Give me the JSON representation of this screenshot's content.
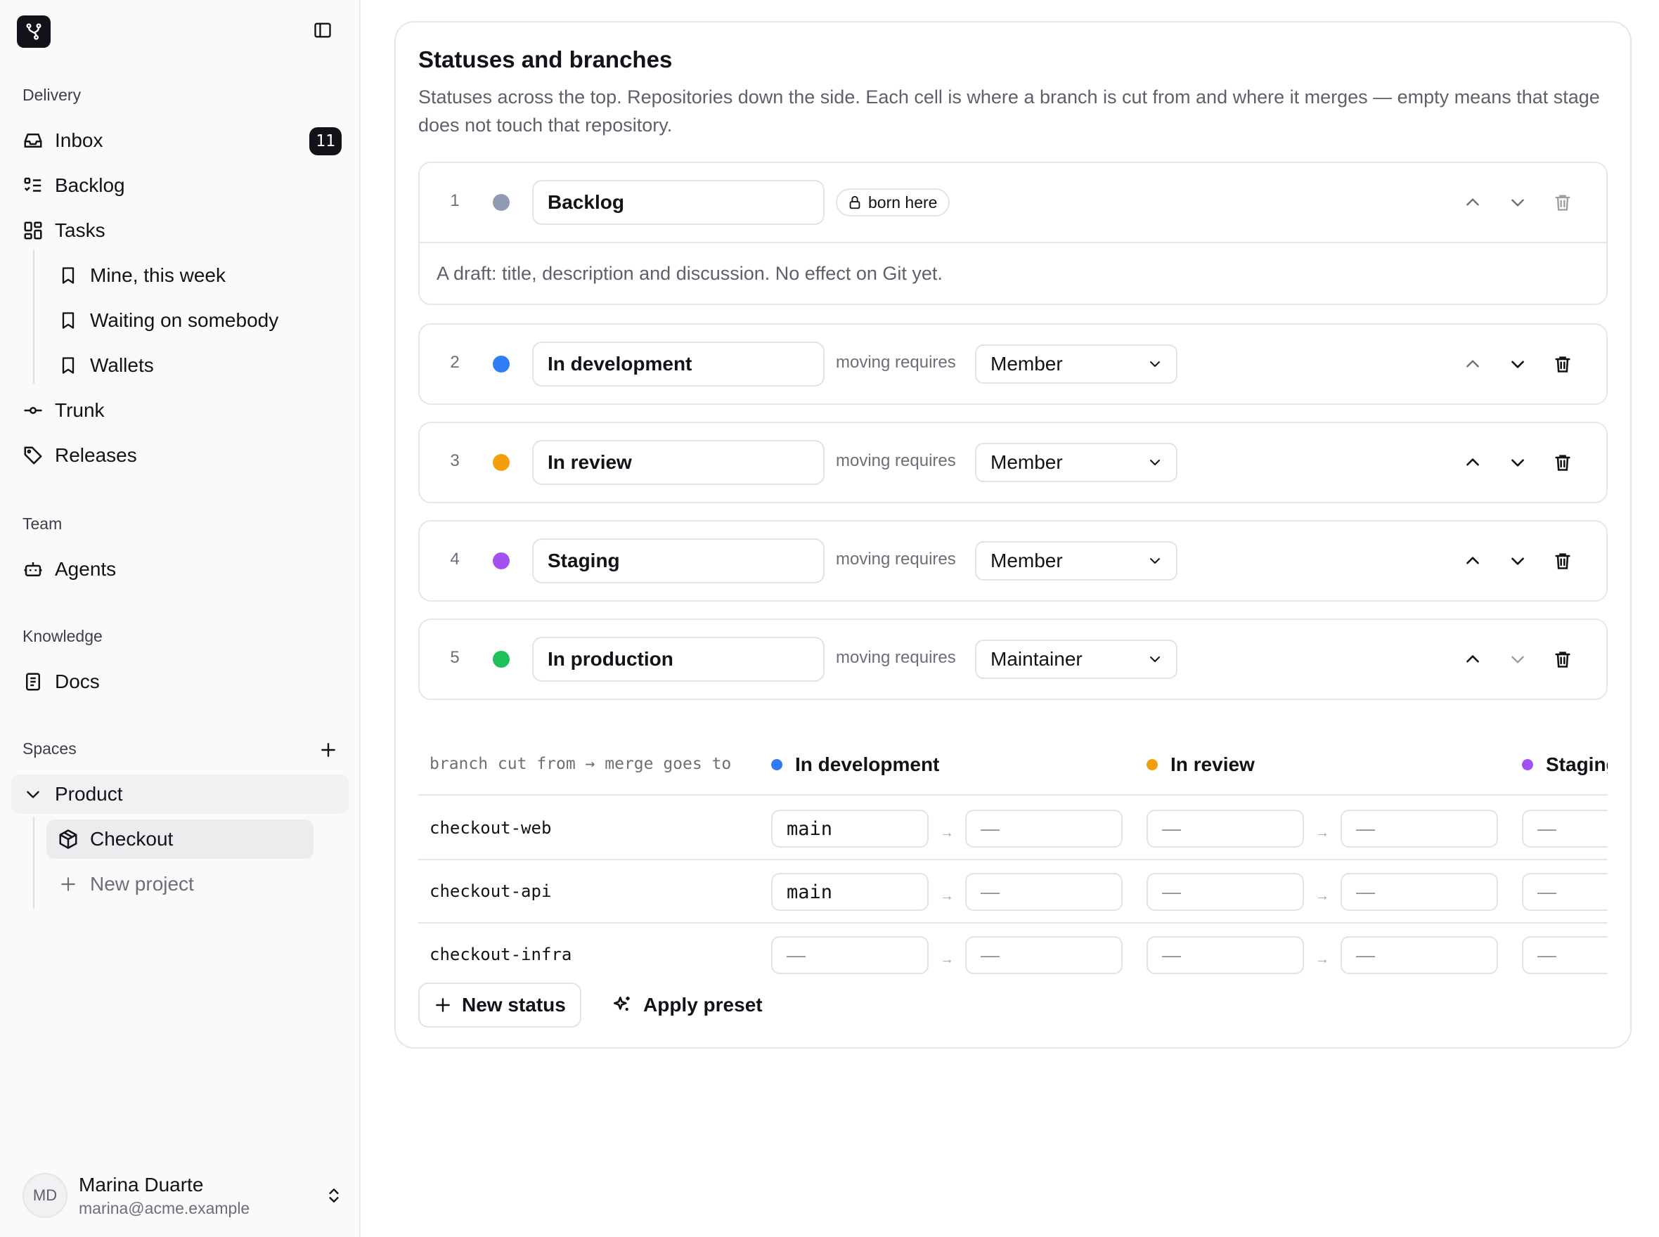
{
  "sidebar": {
    "sections": {
      "delivery": "Delivery",
      "team": "Team",
      "knowledge": "Knowledge",
      "spaces": "Spaces"
    },
    "items": {
      "inbox": {
        "label": "Inbox",
        "badge": "11"
      },
      "backlog": {
        "label": "Backlog"
      },
      "tasks": {
        "label": "Tasks"
      },
      "mine": {
        "label": "Mine, this week"
      },
      "waiting": {
        "label": "Waiting on somebody"
      },
      "wallets": {
        "label": "Wallets"
      },
      "trunk": {
        "label": "Trunk"
      },
      "releases": {
        "label": "Releases"
      },
      "agents": {
        "label": "Agents"
      },
      "docs": {
        "label": "Docs"
      },
      "product": {
        "label": "Product"
      },
      "checkout": {
        "label": "Checkout"
      },
      "new_project": {
        "label": "New project"
      }
    },
    "user": {
      "initials": "MD",
      "name": "Marina Duarte",
      "email": "marina@acme.example"
    }
  },
  "card": {
    "title": "Statuses and branches",
    "description": "Statuses across the top. Repositories down the side. Each cell is where a branch is cut from and where it merges — empty means that stage does not touch that repository.",
    "moving_requires": "moving requires",
    "born_here": "born here"
  },
  "statuses": [
    {
      "num": "1",
      "name": "Backlog",
      "color": "#8f9bb0",
      "description": "A draft: title, description and discussion. No effect on Git yet."
    },
    {
      "num": "2",
      "name": "In development",
      "color": "#2f7cf6",
      "requires": "Member"
    },
    {
      "num": "3",
      "name": "In review",
      "color": "#f59e0b",
      "requires": "Member"
    },
    {
      "num": "4",
      "name": "Staging",
      "color": "#a550f0",
      "requires": "Member"
    },
    {
      "num": "5",
      "name": "In production",
      "color": "#1fbf5a",
      "requires": "Maintainer"
    }
  ],
  "matrix": {
    "corner": "branch cut from → merge goes to",
    "columns": [
      {
        "name": "In development",
        "color": "#2f7cf6"
      },
      {
        "name": "In review",
        "color": "#f59e0b"
      },
      {
        "name": "Staging",
        "color": "#a550f0"
      }
    ],
    "arrow": "→",
    "rows": [
      {
        "repo": "checkout-web",
        "cells": [
          "main",
          "—",
          "—",
          "—",
          "—"
        ]
      },
      {
        "repo": "checkout-api",
        "cells": [
          "main",
          "—",
          "—",
          "—",
          "—"
        ]
      },
      {
        "repo": "checkout-infra",
        "cells": [
          "—",
          "—",
          "—",
          "—",
          "—"
        ]
      }
    ]
  },
  "actions": {
    "new_status": "New status",
    "apply_preset": "Apply preset"
  }
}
